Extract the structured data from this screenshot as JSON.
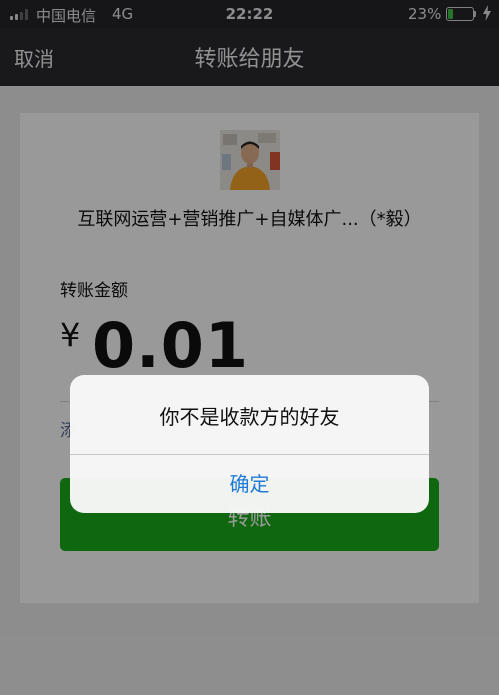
{
  "status_bar": {
    "carrier": "中国电信",
    "network": "4G",
    "time": "22:22",
    "battery_percent": "23%",
    "battery_level": 0.23,
    "icons": [
      "signal-icon",
      "battery-icon",
      "charging-icon"
    ]
  },
  "nav": {
    "cancel_label": "取消",
    "title": "转账给朋友"
  },
  "transfer": {
    "recipient_name": "互联网运营+营销推广+自媒体广...（*毅）",
    "amount_label": "转账金额",
    "currency_symbol": "¥",
    "amount": "0.01",
    "remark_partial": "添",
    "button_label": "转账"
  },
  "alert": {
    "message": "你不是收款方的好友",
    "confirm_label": "确定"
  },
  "colors": {
    "nav_background": "#2b2a2f",
    "button_green": "#1aad19",
    "alert_action_blue": "#1f7bd8",
    "battery_green": "#3ec24a"
  }
}
